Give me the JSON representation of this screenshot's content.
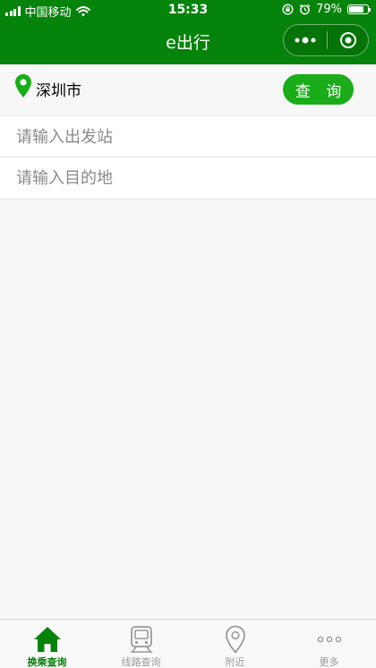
{
  "status_bar": {
    "carrier": "中国移动",
    "time": "15:33",
    "battery_text": "79%",
    "battery_level": 0.79
  },
  "nav": {
    "title": "e出行"
  },
  "location": {
    "city": "深圳市"
  },
  "search": {
    "query_label": "查 询",
    "departure_placeholder": "请输入出发站",
    "destination_placeholder": "请输入目的地"
  },
  "tabs": [
    {
      "label": "换乘查询",
      "icon": "home-icon",
      "active": true
    },
    {
      "label": "线路查询",
      "icon": "train-icon",
      "active": false
    },
    {
      "label": "附近",
      "icon": "location-icon",
      "active": false
    },
    {
      "label": "更多",
      "icon": "more-icon",
      "active": false
    }
  ],
  "colors": {
    "header": "#05830a",
    "accent": "#1aad19",
    "tab_active": "#05830a",
    "tab_inactive": "#9a9a9a"
  }
}
